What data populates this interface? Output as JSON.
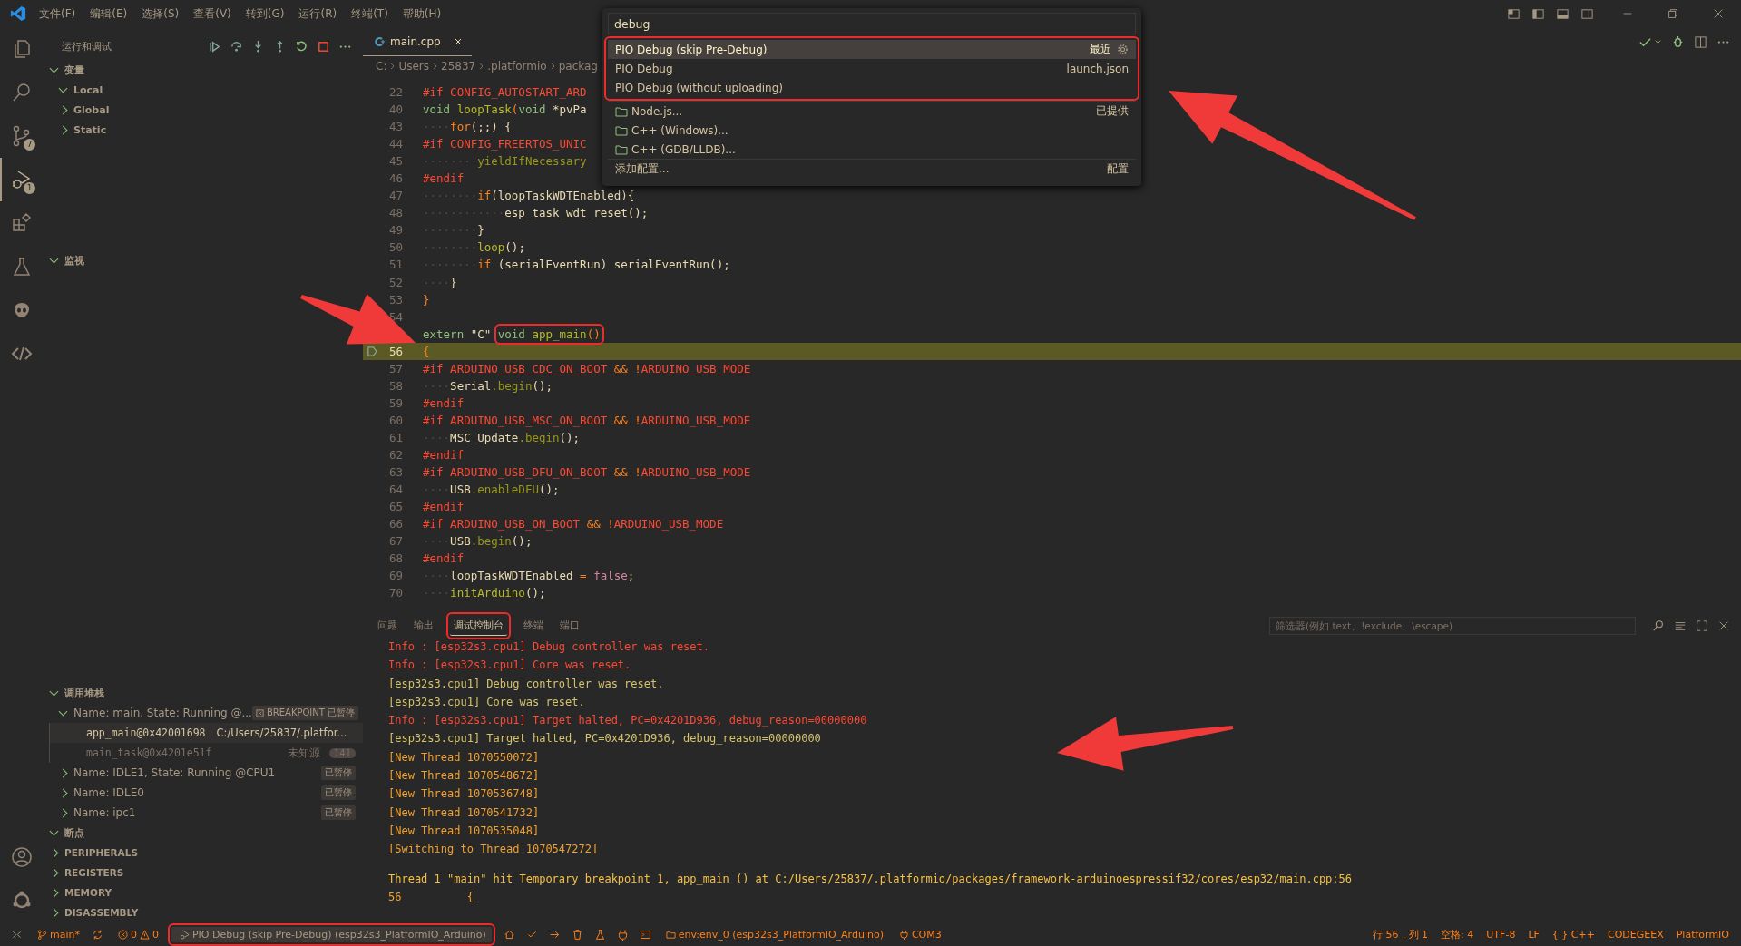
{
  "menu": [
    "文件(F)",
    "编辑(E)",
    "选择(S)",
    "查看(V)",
    "转到(G)",
    "运行(R)",
    "终端(T)",
    "帮助(H)"
  ],
  "activity": [
    {
      "selected": false
    },
    {
      "selected": false
    },
    {
      "selected": false,
      "badge": "7"
    },
    {
      "selected": true,
      "badge": "1"
    },
    {
      "selected": false
    },
    {
      "selected": false
    },
    {
      "selected": false
    },
    {
      "selected": false
    }
  ],
  "sidebar": {
    "title": "运行和调试",
    "variables": {
      "label": "变量",
      "expanded": true,
      "children": [
        {
          "label": "Local",
          "expanded": true
        },
        {
          "label": "Global",
          "expanded": false
        },
        {
          "label": "Static",
          "expanded": false
        }
      ]
    },
    "watch": {
      "label": "监视",
      "expanded": true
    },
    "call_stack": {
      "label": "调用堆栈",
      "expanded": true,
      "threads": [
        {
          "name": "Name: main, State: Running @...",
          "status": "BREAKPOINT 已暂停",
          "expanded": true,
          "frames": [
            {
              "name": "app_main@0x42001698",
              "source": "C:/Users/25837/.platfor...",
              "selected": true,
              "dimmed": false
            },
            {
              "name": "main_task@0x4201e51f",
              "source": "未知源",
              "count": "141",
              "selected": false,
              "dimmed": true
            }
          ]
        },
        {
          "name": "Name: IDLE1, State: Running @CPU1",
          "status": "已暂停",
          "expanded": false
        },
        {
          "name": "Name: IDLE0",
          "status": "已暂停",
          "expanded": false
        },
        {
          "name": "Name: ipc1",
          "status": "已暂停",
          "expanded": false
        }
      ]
    },
    "breakpoints": {
      "label": "断点",
      "expanded": true
    },
    "extra_sections": [
      {
        "label": "PERIPHERALS",
        "expanded": false
      },
      {
        "label": "REGISTERS",
        "expanded": false
      },
      {
        "label": "MEMORY",
        "expanded": false
      },
      {
        "label": "DISASSEMBLY",
        "expanded": false
      }
    ]
  },
  "editor": {
    "tab": {
      "label": "main.cpp",
      "selected": true
    },
    "breadcrumb": [
      "C:",
      "Users",
      "25837",
      ".platformio",
      "packag"
    ],
    "lines": [
      {
        "n": "22",
        "tokens": [
          {
            "t": "#if CONFIG_AUTOSTART_ARD",
            "kind": "pp"
          }
        ]
      },
      {
        "n": "40",
        "tokens": [
          {
            "t": "void",
            "kind": "kw"
          },
          {
            "t": " loopTask",
            "kind": "fn"
          },
          {
            "t": "(",
            "kind": "op"
          },
          {
            "t": "void",
            "kind": "kw"
          },
          {
            "t": " *pvPa",
            "kind": "id"
          }
        ]
      },
      {
        "n": "43",
        "tokens": [
          {
            "t": "····",
            "kind": "ws"
          },
          {
            "t": "for",
            "kind": "op"
          },
          {
            "t": "(;;) {",
            "kind": "id"
          }
        ]
      },
      {
        "n": "44",
        "tokens": [
          {
            "t": "#if CONFIG_FREERTOS_UNIC",
            "kind": "pp"
          }
        ]
      },
      {
        "n": "45",
        "tokens": [
          {
            "t": "········",
            "kind": "ws"
          },
          {
            "t": "yieldIfNecessary",
            "kind": "dim"
          }
        ]
      },
      {
        "n": "46",
        "tokens": [
          {
            "t": "#endif",
            "kind": "pp"
          }
        ]
      },
      {
        "n": "47",
        "tokens": [
          {
            "t": "········",
            "kind": "ws"
          },
          {
            "t": "if",
            "kind": "op"
          },
          {
            "t": "(loopTaskWDTEnabled){",
            "kind": "id"
          }
        ]
      },
      {
        "n": "48",
        "tokens": [
          {
            "t": "············",
            "kind": "ws"
          },
          {
            "t": "esp_task_wdt_reset",
            "kind": "id"
          },
          {
            "t": "();",
            "kind": "id"
          }
        ]
      },
      {
        "n": "49",
        "tokens": [
          {
            "t": "········",
            "kind": "ws"
          },
          {
            "t": "}",
            "kind": "id"
          }
        ]
      },
      {
        "n": "50",
        "tokens": [
          {
            "t": "········",
            "kind": "ws"
          },
          {
            "t": "loop",
            "kind": "fn"
          },
          {
            "t": "();",
            "kind": "id"
          }
        ]
      },
      {
        "n": "51",
        "tokens": [
          {
            "t": "········",
            "kind": "ws"
          },
          {
            "t": "if",
            "kind": "op"
          },
          {
            "t": " (serialEventRun) serialEventRun();",
            "kind": "id"
          }
        ]
      },
      {
        "n": "52",
        "tokens": [
          {
            "t": "····",
            "kind": "ws"
          },
          {
            "t": "}",
            "kind": "id"
          }
        ]
      },
      {
        "n": "53",
        "tokens": [
          {
            "t": "}",
            "kind": "op"
          }
        ]
      },
      {
        "n": "54"
      },
      {
        "tokens": [
          {
            "t": "extern",
            "kind": "kw"
          },
          {
            "t": " \"C\" ",
            "kind": "id"
          },
          {
            "t": "void",
            "kind": "kw",
            "boxed": true
          },
          {
            "t": " app_main",
            "kind": "fn",
            "boxed": true
          },
          {
            "t": "()",
            "kind": "op",
            "boxed": true
          }
        ]
      },
      {
        "n": "56",
        "current": true,
        "tokens": [
          {
            "t": "{",
            "kind": "op"
          }
        ]
      },
      {
        "n": "57",
        "tokens": [
          {
            "t": "#if ARDUINO_USB_CDC_ON_BOOT ",
            "kind": "pp"
          },
          {
            "t": "&&",
            "kind": "op"
          },
          {
            "t": " !",
            "kind": "op"
          },
          {
            "t": "ARDUINO_USB_MODE",
            "kind": "pp"
          }
        ]
      },
      {
        "n": "58",
        "tokens": [
          {
            "t": "····",
            "kind": "ws"
          },
          {
            "t": "Serial",
            "kind": "id"
          },
          {
            "t": ".begin",
            "kind": "dim"
          },
          {
            "t": "();",
            "kind": "id"
          }
        ]
      },
      {
        "n": "59",
        "tokens": [
          {
            "t": "#endif",
            "kind": "pp"
          }
        ]
      },
      {
        "n": "60",
        "tokens": [
          {
            "t": "#if ARDUINO_USB_MSC_ON_BOOT ",
            "kind": "pp"
          },
          {
            "t": "&&",
            "kind": "op"
          },
          {
            "t": " !",
            "kind": "op"
          },
          {
            "t": "ARDUINO_USB_MODE",
            "kind": "pp"
          }
        ]
      },
      {
        "n": "61",
        "tokens": [
          {
            "t": "····",
            "kind": "ws"
          },
          {
            "t": "MSC_Update",
            "kind": "id"
          },
          {
            "t": ".begin",
            "kind": "dim"
          },
          {
            "t": "();",
            "kind": "id"
          }
        ]
      },
      {
        "n": "62",
        "tokens": [
          {
            "t": "#endif",
            "kind": "pp"
          }
        ]
      },
      {
        "n": "63",
        "tokens": [
          {
            "t": "#if ARDUINO_USB_DFU_ON_BOOT ",
            "kind": "pp"
          },
          {
            "t": "&&",
            "kind": "op"
          },
          {
            "t": " !",
            "kind": "op"
          },
          {
            "t": "ARDUINO_USB_MODE",
            "kind": "pp"
          }
        ]
      },
      {
        "n": "64",
        "tokens": [
          {
            "t": "····",
            "kind": "ws"
          },
          {
            "t": "USB",
            "kind": "id"
          },
          {
            "t": ".enableDFU",
            "kind": "dim"
          },
          {
            "t": "();",
            "kind": "id"
          }
        ]
      },
      {
        "n": "65",
        "tokens": [
          {
            "t": "#endif",
            "kind": "pp"
          }
        ]
      },
      {
        "n": "66",
        "tokens": [
          {
            "t": "#if ARDUINO_USB_ON_BOOT ",
            "kind": "pp"
          },
          {
            "t": "&&",
            "kind": "op"
          },
          {
            "t": " !",
            "kind": "op"
          },
          {
            "t": "ARDUINO_USB_MODE",
            "kind": "pp"
          }
        ]
      },
      {
        "n": "67",
        "tokens": [
          {
            "t": "····",
            "kind": "ws"
          },
          {
            "t": "USB",
            "kind": "id"
          },
          {
            "t": ".begin",
            "kind": "dim"
          },
          {
            "t": "();",
            "kind": "id"
          }
        ]
      },
      {
        "n": "68",
        "tokens": [
          {
            "t": "#endif",
            "kind": "pp"
          }
        ]
      },
      {
        "n": "69",
        "tokens": [
          {
            "t": "····",
            "kind": "ws"
          },
          {
            "t": "loopTaskWDTEnabled ",
            "kind": "id"
          },
          {
            "t": "=",
            "kind": "op"
          },
          {
            "t": " false",
            "kind": "const"
          },
          {
            "t": ";",
            "kind": "id"
          }
        ]
      },
      {
        "n": "70",
        "tokens": [
          {
            "t": "····",
            "kind": "ws"
          },
          {
            "t": "initArduino",
            "kind": "fn"
          },
          {
            "t": "();",
            "kind": "id"
          }
        ]
      }
    ]
  },
  "quick_pick": {
    "value": "debug",
    "groups": [
      {
        "annotated": true,
        "items": [
          {
            "label": "PIO Debug (skip Pre-Debug)",
            "detail": "最近",
            "selected": true,
            "gear": true
          },
          {
            "label": "PIO Debug",
            "detail": "launch.json",
            "selected": false
          },
          {
            "label": "PIO Debug (without uploading)",
            "selected": false
          }
        ]
      },
      {
        "annotated": false,
        "items": [
          {
            "label": "Node.js...",
            "detail": "已提供",
            "selected": false,
            "folder": true
          },
          {
            "label": "C++ (Windows)...",
            "selected": false,
            "folder": true
          },
          {
            "label": "C++ (GDB/LLDB)...",
            "selected": false,
            "folder": true
          }
        ]
      },
      {
        "annotated": false,
        "items": [
          {
            "label": "添加配置...",
            "detail": "配置",
            "selected": false
          }
        ]
      }
    ]
  },
  "panel": {
    "tabs": [
      {
        "label": "问题",
        "selected": false,
        "annotated": false
      },
      {
        "label": "输出",
        "selected": false,
        "annotated": false
      },
      {
        "label": "调试控制台",
        "selected": true,
        "annotated": true
      },
      {
        "label": "终端",
        "selected": false,
        "annotated": false
      },
      {
        "label": "端口",
        "selected": false,
        "annotated": false
      }
    ],
    "filter_placeholder": "筛选器(例如 text、!exclude、\\escape)",
    "output": [
      {
        "kind": "info",
        "text": "Info : [esp32s3.cpu1] Debug controller was reset."
      },
      {
        "kind": "info",
        "text": "Info : [esp32s3.cpu1] Core was reset."
      },
      {
        "kind": "target",
        "text": "[esp32s3.cpu1] Debug controller was reset."
      },
      {
        "kind": "target",
        "text": "[esp32s3.cpu1] Core was reset."
      },
      {
        "kind": "info",
        "text": "Info : [esp32s3.cpu1] Target halted, PC=0x4201D936, debug_reason=00000000"
      },
      {
        "kind": "target",
        "text": "[esp32s3.cpu1] Target halted, PC=0x4201D936, debug_reason=00000000"
      },
      {
        "kind": "thread",
        "text": "[New Thread 1070550072]"
      },
      {
        "kind": "thread",
        "text": "[New Thread 1070548672]"
      },
      {
        "kind": "thread",
        "text": "[New Thread 1070536748]"
      },
      {
        "kind": "thread",
        "text": "[New Thread 1070541732]"
      },
      {
        "kind": "thread",
        "text": "[New Thread 1070535048]"
      },
      {
        "kind": "thread",
        "text": "[Switching to Thread 1070547272]"
      },
      {
        "kind": "stop",
        "text": "Thread 1 \"main\" hit Temporary breakpoint 1, app_main () at C:/Users/25837/.platformio/packages/framework-arduinoespressif32/cores/esp32/main.cpp:56"
      },
      {
        "kind": "thread",
        "text": "56\t    {"
      }
    ]
  },
  "status_bar": {
    "branch": "main*",
    "errors": "0",
    "warnings": "0",
    "debug_config": {
      "label": "PIO Debug (skip Pre-Debug) (esp32s3_PlatformIO_Arduino)",
      "annotated": true
    },
    "env": "env:env_0 (esp32s3_PlatformIO_Arduino)",
    "port": "COM3",
    "right": [
      "行 56，列 1",
      "空格: 4",
      "UTF-8",
      "LF",
      "{ } C++",
      "CODEGEEX",
      "PlatformIO"
    ]
  }
}
